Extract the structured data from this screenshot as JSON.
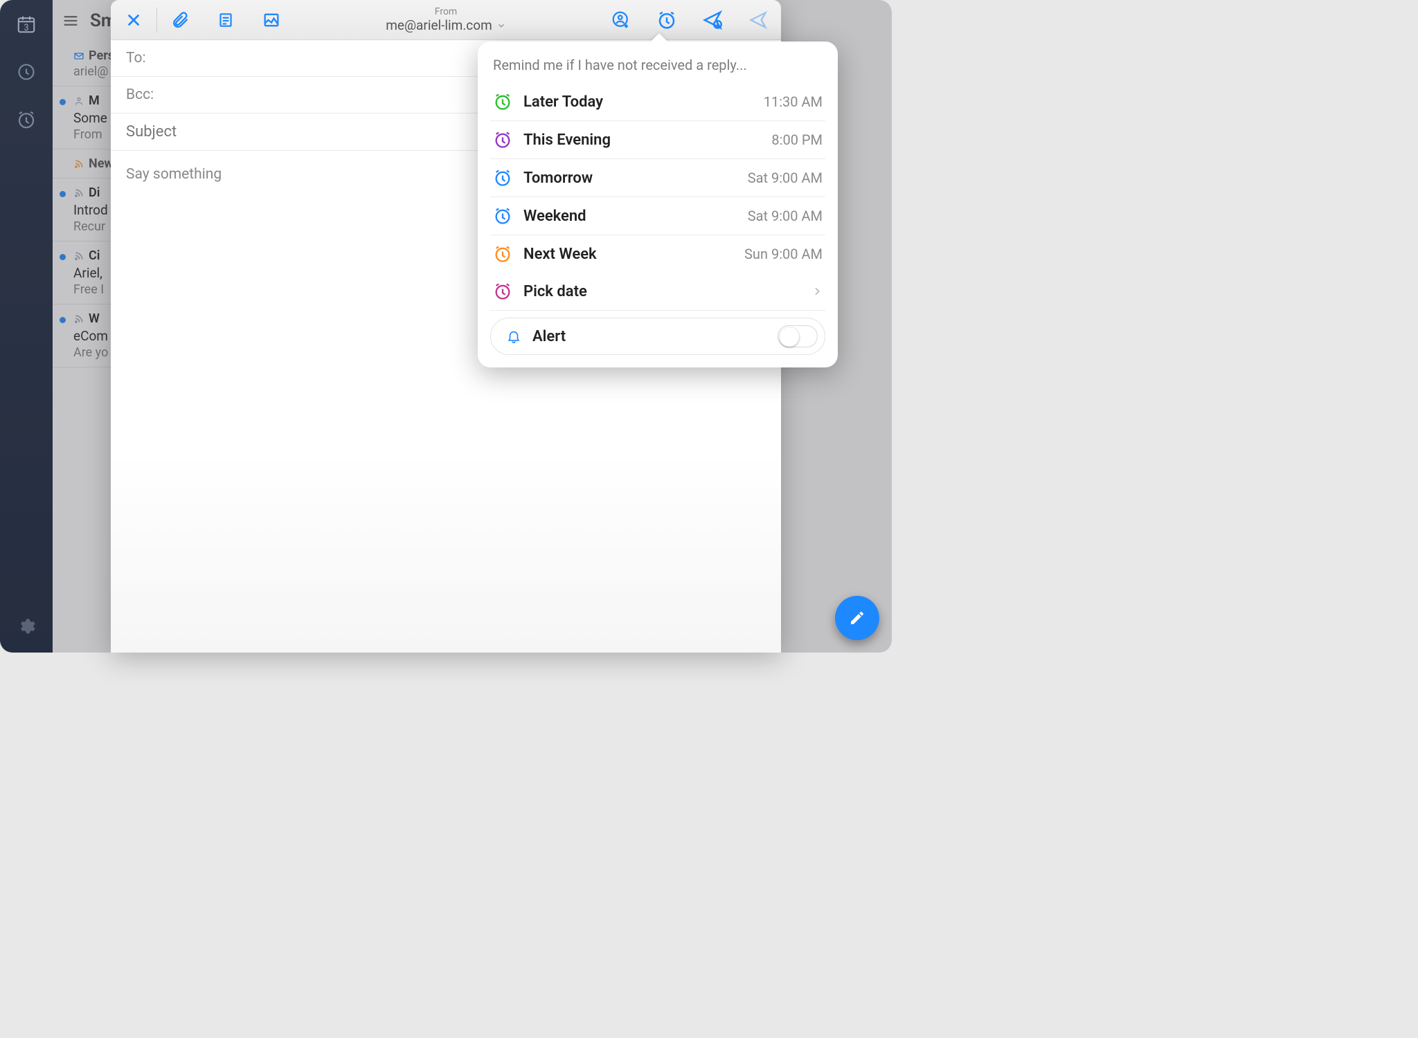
{
  "rail": {
    "calendar_day": "3"
  },
  "list": {
    "header_title": "Sm",
    "items": [
      {
        "l1": "Person",
        "l1b": "ariel@",
        "unread": false,
        "icon": "mail"
      },
      {
        "l1": "M",
        "l2": "Some",
        "l3": "From",
        "unread": true,
        "icon": "person"
      },
      {
        "l1": "Newsl",
        "unread": false,
        "icon": "rss",
        "section": true
      },
      {
        "l1": "Di",
        "l2": "Introd",
        "l3": "Recur",
        "unread": true,
        "icon": "rss"
      },
      {
        "l1": "Ci",
        "l2": "Ariel,",
        "l3": "Free I",
        "unread": true,
        "icon": "rss"
      },
      {
        "l1": "W",
        "l2": "eCom",
        "l3": "Are yo",
        "unread": true,
        "icon": "rss"
      }
    ]
  },
  "compose": {
    "from_label": "From",
    "from_address": "me@ariel-lim.com",
    "to_label": "To:",
    "bcc_label": "Bcc:",
    "subject_placeholder": "Subject",
    "body_placeholder": "Say something"
  },
  "reminder": {
    "title": "Remind me if I have not received a reply...",
    "options": [
      {
        "label": "Later Today",
        "time": "11:30 AM",
        "color": "#2bbf2b"
      },
      {
        "label": "This Evening",
        "time": "8:00 PM",
        "color": "#9335c8"
      },
      {
        "label": "Tomorrow",
        "time": "Sat 9:00 AM",
        "color": "#1e88ff"
      },
      {
        "label": "Weekend",
        "time": "Sat 9:00 AM",
        "color": "#1e88ff"
      },
      {
        "label": "Next Week",
        "time": "Sun 9:00 AM",
        "color": "#ff8c1a"
      }
    ],
    "pick_date_label": "Pick date",
    "pick_date_color": "#c4338f",
    "alert_label": "Alert",
    "alert_on": false
  }
}
